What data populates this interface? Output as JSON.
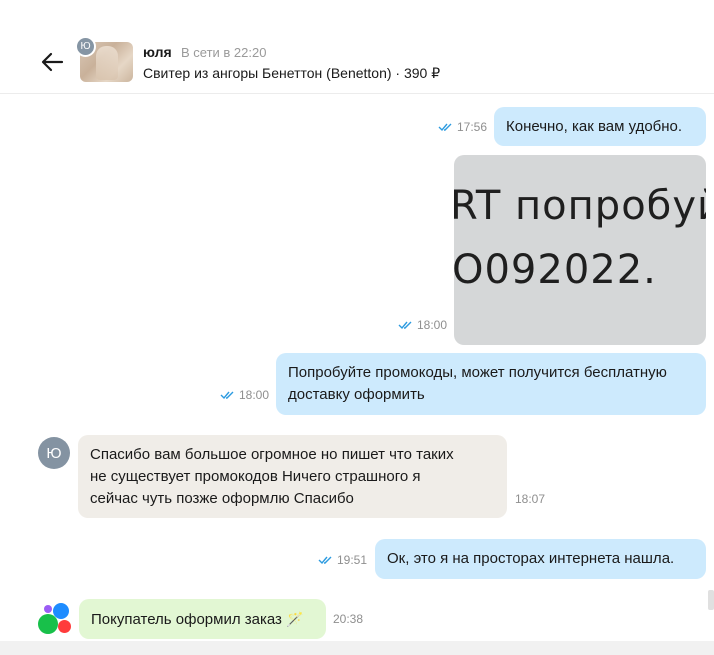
{
  "header": {
    "avatar_letter": "Ю",
    "name": "юля",
    "status": "В сети в 22:20",
    "product": "Свитер из ангоры Бенеттон (Benetton) · 390 ₽"
  },
  "messages": [
    {
      "text": "Конечно, как вам удобно.",
      "time": "17:56",
      "direction": "out",
      "read": true
    },
    {
      "image_text_line1": "RT попробуй",
      "image_text_line2": "O092022.",
      "time": "18:00",
      "direction": "out",
      "read": true
    },
    {
      "text_line1": "Попробуйте промокоды, может получится бесплатную",
      "text_line2": "доставку оформить",
      "time": "18:00",
      "direction": "out",
      "read": true
    },
    {
      "text_line1": "Спасибо вам большое огромное но пишет что таких",
      "text_line2": "не существует промокодов Ничего страшного я",
      "text_line3": "сейчас чуть позже оформлю Спасибо",
      "time": "18:07",
      "direction": "in",
      "avatar_letter": "Ю"
    },
    {
      "text": "Ок, это я на просторах интернета нашла.",
      "time": "19:51",
      "direction": "out",
      "read": true
    },
    {
      "text": "Покупатель оформил заказ",
      "emoji": "🪄",
      "time": "20:38",
      "direction": "system"
    }
  ],
  "colors": {
    "outgoing_bubble": "#cdeafd",
    "incoming_bubble": "#f0ede8",
    "system_bubble": "#e2f7d3",
    "read_checks": "#2c9be0",
    "logo_purple": "#9b5cf5",
    "logo_blue": "#1e8cff",
    "logo_green": "#18c04a",
    "logo_red": "#ff3c3c"
  }
}
